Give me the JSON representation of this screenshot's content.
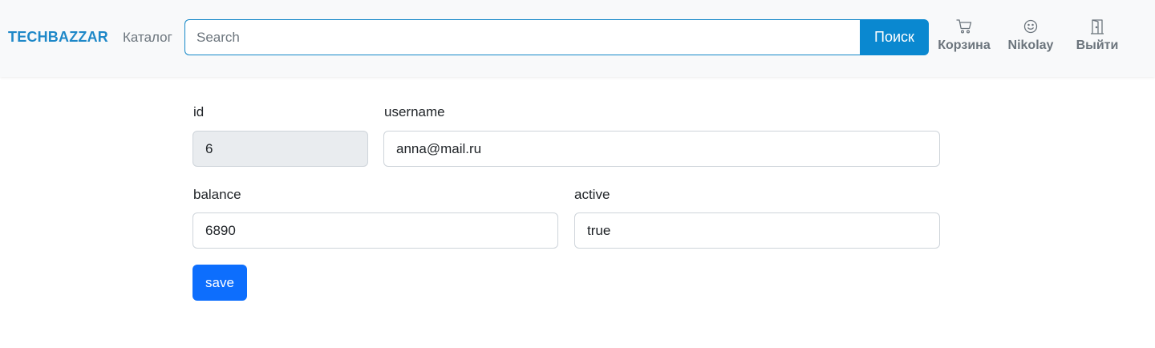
{
  "navbar": {
    "brand": "TECHBAZZAR",
    "catalog_label": "Каталог",
    "search": {
      "placeholder": "Search",
      "value": "",
      "button_label": "Поиск"
    },
    "cart": {
      "label": "Корзина",
      "icon": "cart-icon"
    },
    "user": {
      "label": "Nikolay",
      "icon": "smiley-icon"
    },
    "logout": {
      "label": "Выйти",
      "icon": "door-icon"
    }
  },
  "form": {
    "id": {
      "label": "id",
      "value": "6"
    },
    "username": {
      "label": "username",
      "value": "anna@mail.ru"
    },
    "balance": {
      "label": "balance",
      "value": "6890"
    },
    "active": {
      "label": "active",
      "value": "true"
    },
    "save_label": "save"
  },
  "colors": {
    "brand": "#1e88c8",
    "search_button": "#0a88d0",
    "primary_button": "#0d6efd",
    "navbar_bg": "#f8f9fa",
    "readonly_bg": "#e9ecef"
  }
}
